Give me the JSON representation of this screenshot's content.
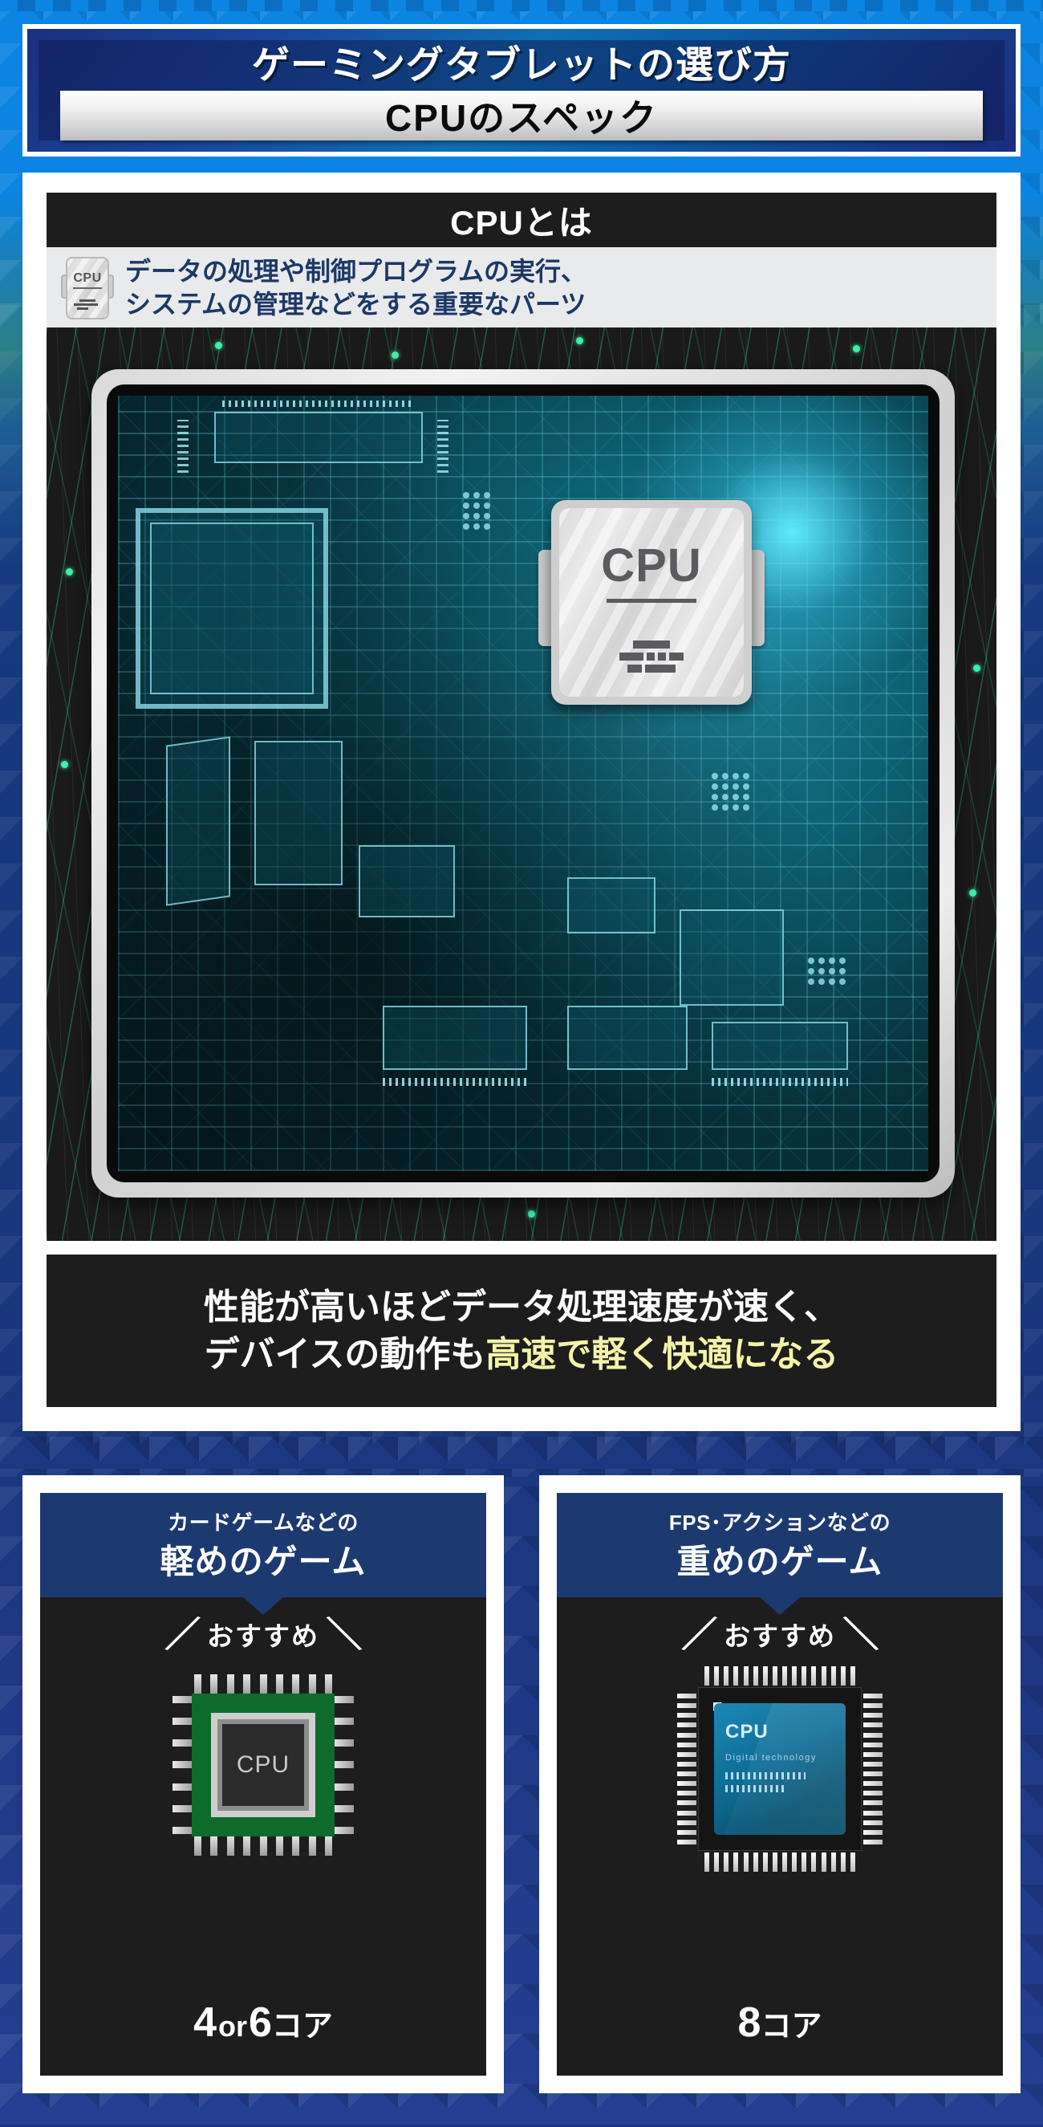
{
  "header": {
    "title_main": "ゲーミングタブレットの選び方",
    "title_sub": "CPUのスペック"
  },
  "cpu_section": {
    "heading": "CPUとは",
    "icon_label": "CPU",
    "description": "データの処理や制御プログラムの実行、\nシステムの管理などをする重要なパーツ",
    "illustration": {
      "chip_label": "CPU",
      "device": "tablet-with-circuit-board"
    },
    "conclusion_line1": "性能が高いほどデータ処理速度が速く、",
    "conclusion_line2_plain": "デバイスの動作も",
    "conclusion_line2_highlight": "高速で軽く快適になる",
    "highlight_color": "#f5f3a8"
  },
  "cards": [
    {
      "head_small": "カードゲームなどの",
      "head_large": "軽めのゲーム",
      "recommend_label": "おすすめ",
      "chip_label": "CPU",
      "core_value": "4",
      "core_sep": "or",
      "core_value2": "6",
      "core_unit": "コア",
      "chip_color": "#0f6b2c"
    },
    {
      "head_small": "FPS･アクションなどの",
      "head_large": "重めのゲーム",
      "recommend_label": "おすすめ",
      "chip_label": "CPU",
      "chip_tagline": "Digital technology",
      "core_value": "8",
      "core_unit": "コア",
      "chip_color": "#0e6e97"
    }
  ],
  "theme": {
    "bg_blue_top": "#0b84e2",
    "bg_navy": "#1b3080",
    "panel_white": "#ffffff",
    "black_box": "#1d1d1d",
    "card_head_navy": "#1d3a70",
    "desc_text_navy": "#1c3866"
  }
}
